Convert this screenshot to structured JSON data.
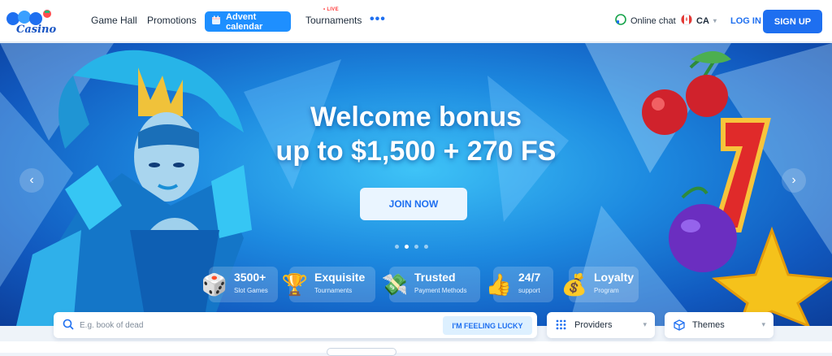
{
  "header": {
    "logo_text": "Casino",
    "nav": {
      "game_hall": "Game Hall",
      "promotions": "Promotions",
      "advent_calendar": "Advent calendar",
      "tournaments": "Tournaments",
      "live_badge": "• LIVE",
      "more": "•••"
    },
    "online_chat": "Online chat",
    "country_code": "CA",
    "login": "LOG IN",
    "signup": "SIGN UP"
  },
  "banner": {
    "title_line1": "Welcome bonus",
    "title_line2": "up to $1,500 + 270 FS",
    "join_button": "JOIN NOW",
    "slides_count": 4,
    "active_slide": 2,
    "prev_arrow": "‹",
    "next_arrow": "›"
  },
  "features": [
    {
      "title": "3500+",
      "subtitle": "Slot Games",
      "icon": "dice-icon"
    },
    {
      "title": "Exquisite",
      "subtitle": "Tournaments",
      "icon": "trophy-icon"
    },
    {
      "title": "Trusted",
      "subtitle": "Payment Methods",
      "icon": "money-icon"
    },
    {
      "title": "24/7",
      "subtitle": "support",
      "icon": "thumbs-up-icon"
    },
    {
      "title": "Loyalty",
      "subtitle": "Program",
      "icon": "money-bag-icon"
    }
  ],
  "search": {
    "placeholder": "E.g. book of dead",
    "lucky_button": "I'M FEELING LUCKY"
  },
  "filters": {
    "providers": "Providers",
    "themes": "Themes"
  },
  "colors": {
    "accent": "#1e6ff0",
    "advent": "#1e8fff",
    "live": "#ff3b3b",
    "flag_red": "#e53935"
  }
}
